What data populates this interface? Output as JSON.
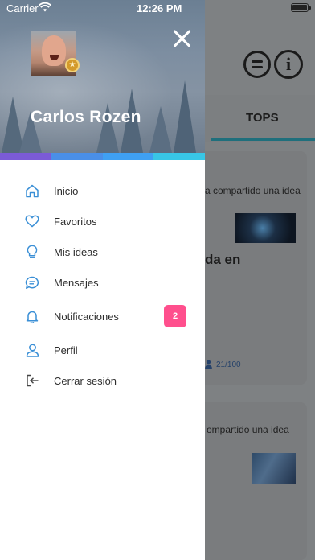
{
  "status_bar": {
    "carrier": "Carrier",
    "time": "12:26 PM"
  },
  "background": {
    "tab_tops": "TOPS",
    "card1_text": "a compartido una idea",
    "card1_title": "da en",
    "card1_progress": "21/100",
    "card2_text": "ompartido una idea"
  },
  "drawer": {
    "user_name": "Carlos Rozen",
    "color_strip": [
      "#7b5bd6",
      "#4a8fe7",
      "#3fa0f2",
      "#38c6e6"
    ],
    "menu": [
      {
        "label": "Inicio",
        "icon": "home-icon"
      },
      {
        "label": "Favoritos",
        "icon": "heart-icon"
      },
      {
        "label": "Mis ideas",
        "icon": "lightbulb-icon"
      },
      {
        "label": "Mensajes",
        "icon": "message-icon"
      },
      {
        "label": "Notificaciones",
        "icon": "bell-icon",
        "badge": "2"
      },
      {
        "label": "Perfil",
        "icon": "user-icon"
      },
      {
        "label": "Cerrar sesión",
        "icon": "logout-icon"
      }
    ]
  },
  "colors": {
    "icon_blue": "#3a8fd6",
    "badge_pink": "#ff4f8d",
    "overlay": "#7e8183"
  }
}
